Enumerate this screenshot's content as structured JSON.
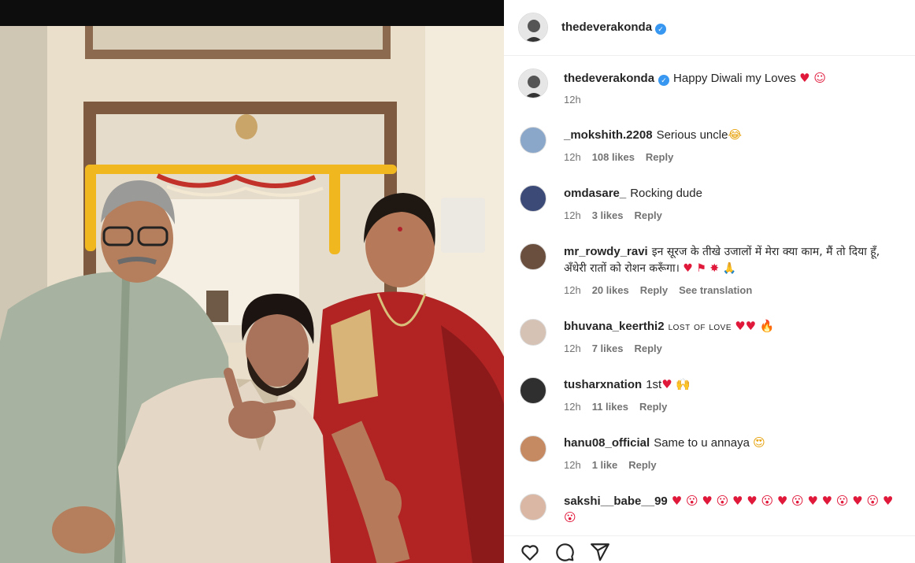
{
  "post": {
    "author": "thedeverakonda",
    "verified": true,
    "caption": "Happy Diwali my Loves",
    "caption_emojis": "♥ ☺",
    "caption_time": "12h"
  },
  "comments": [
    {
      "user": "_mokshith.2208",
      "text": "Serious uncle",
      "emoji": "😂",
      "time": "12h",
      "likes": "108 likes",
      "reply": "Reply"
    },
    {
      "user": "omdasare_",
      "text": "Rocking dude",
      "emoji": "",
      "time": "12h",
      "likes": "3 likes",
      "reply": "Reply"
    },
    {
      "user": "mr_rowdy_ravi",
      "text": "इन सूरज के तीखे उजालों में मेरा क्या काम, मैं तो दिया हूँ, अँधेरी रातों को रोशन करूँगा।",
      "emoji": "♥ ⚑ ✸ 🙏",
      "time": "12h",
      "likes": "20 likes",
      "reply": "Reply",
      "translate": "See translation"
    },
    {
      "user": "bhuvana_keerthi2",
      "text": "lost of love",
      "emoji": "♥♥ 🔥",
      "time": "12h",
      "likes": "7 likes",
      "reply": "Reply"
    },
    {
      "user": "tusharxnation",
      "text": "1st",
      "emoji": "♥ 🙌",
      "time": "12h",
      "likes": "11 likes",
      "reply": "Reply"
    },
    {
      "user": "hanu08_official",
      "text": "Same to u annaya",
      "emoji": "😍",
      "time": "12h",
      "likes": "1 like",
      "reply": "Reply"
    },
    {
      "user": "sakshi__babe__99",
      "text": "",
      "emoji": "♥ 😮 ♥ 😮 ♥ ♥ 😮 ♥ 😮 ♥ ♥ 😮 ♥ 😮 ♥ 😮",
      "time": "",
      "likes": "",
      "reply": ""
    }
  ],
  "icons": {
    "like": "heart-icon",
    "comment": "comment-icon",
    "share": "share-icon",
    "verified": "verified-badge-icon"
  },
  "colors": {
    "verified_blue": "#3897f0",
    "text": "#262626",
    "muted": "#737373",
    "heart_red": "#e0193b"
  }
}
